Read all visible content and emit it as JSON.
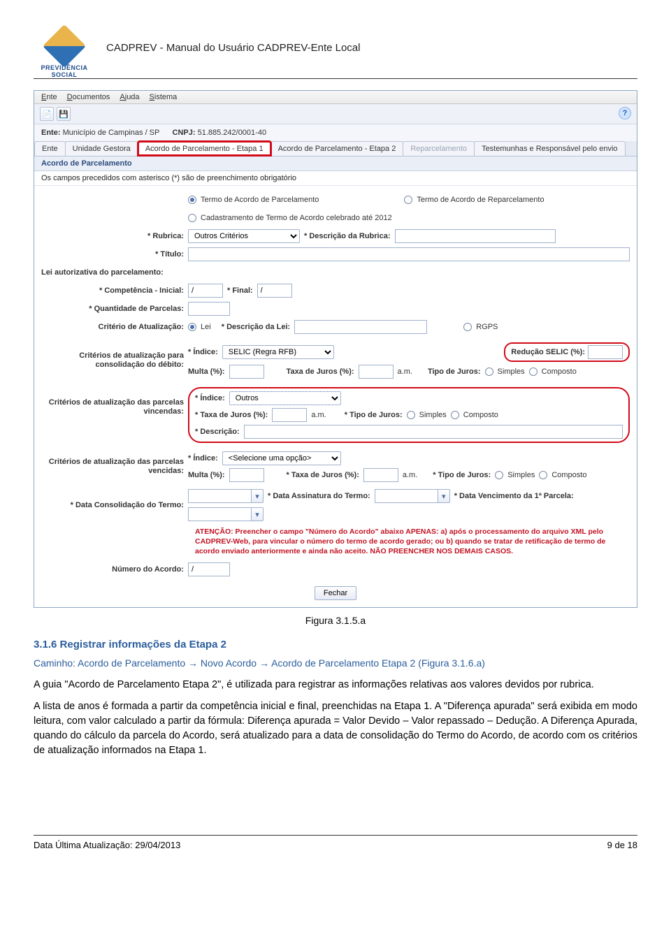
{
  "header": {
    "brand": "PREVIDÊNCIA SOCIAL",
    "title": "CADPREV - Manual do Usuário CADPREV-Ente Local"
  },
  "app": {
    "menu": {
      "ente": "Ente",
      "documentos": "Documentos",
      "ajuda": "Ajuda",
      "sistema": "Sistema"
    },
    "toolIcons": {
      "newDoc": "📄",
      "save": "💾",
      "help": "?"
    },
    "ente": {
      "label": "Ente:",
      "value": "Município de Campinas / SP",
      "cnpj_label": "CNPJ:",
      "cnpj_value": "51.885.242/0001-40"
    },
    "tabs": {
      "t1": "Ente",
      "t2": "Unidade Gestora",
      "t3": "Acordo de Parcelamento - Etapa 1",
      "t4": "Acordo de Parcelamento - Etapa 2",
      "t5": "Reparcelamento",
      "t6": "Testemunhas e Responsável pelo envio"
    },
    "section_title": "Acordo de Parcelamento",
    "hint": "Os campos precedidos com asterisco (*) são de preenchimento obrigatório",
    "radios": {
      "r1": "Termo de Acordo de Parcelamento",
      "r2": "Termo de Acordo de Reparcelamento",
      "r3": "Cadastramento de Termo de Acordo celebrado até 2012"
    },
    "labels": {
      "rubrica": "* Rubrica:",
      "desc_rubrica": "* Descrição da Rubrica:",
      "titulo": "* Título:",
      "lei_aut": "Lei autorizativa do parcelamento:",
      "comp_inicial": "* Competência - Inicial:",
      "final": "* Final:",
      "qtd_parcelas": "* Quantidade de Parcelas:",
      "crit_atual": "Critério de Atualização:",
      "lei_opt": "Lei",
      "desc_lei": "* Descrição da Lei:",
      "rgps": "RGPS",
      "crit_debito": "Critérios de atualização para consolidação do débito:",
      "crit_vincendas": "Critérios de atualização das parcelas vincendas:",
      "crit_vencidas": "Critérios de atualização das parcelas vencidas:",
      "indice": "* Índice:",
      "reducao_selic": "Redução SELIC (%):",
      "multa": "Multa (%):",
      "taxa_juros": "Taxa de Juros (%):",
      "taxa_juros_req": "* Taxa de Juros (%):",
      "am": "a.m.",
      "tipo_juros": "Tipo de Juros:",
      "tipo_juros_req": "* Tipo de Juros:",
      "simples": "Simples",
      "composto": "Composto",
      "descricao": "* Descrição:",
      "data_consol": "* Data Consolidação do Termo:",
      "data_assin": "* Data Assinatura do Termo:",
      "data_venc": "* Data Vencimento da 1ª Parcela:",
      "num_acordo": "Número do Acordo:"
    },
    "selects": {
      "rubrica": "Outros Critérios",
      "indice_debito": "SELIC (Regra RFB)",
      "indice_vincendas": "Outros",
      "indice_vencidas": "<Selecione uma opção>"
    },
    "values": {
      "slash": "/",
      "empty": ""
    },
    "warn": "ATENÇÃO: Preencher o campo \"Número do Acordo\" abaixo APENAS: a) após o processamento do arquivo XML pelo CADPREV-Web, para vincular o número do termo de acordo gerado; ou b) quando se tratar de retificação de termo de acordo enviado anteriormente e ainda não aceito. NÃO PREENCHER NOS DEMAIS CASOS.",
    "close_btn": "Fechar"
  },
  "figure_caption": "Figura 3.1.5.a",
  "section": {
    "heading": "3.1.6  Registrar informações da Etapa 2",
    "path": "Caminho: Acordo de Parcelamento → Novo Acordo → Acordo de Parcelamento Etapa 2 (Figura 3.1.6.a)",
    "p1": "A guia \"Acordo de Parcelamento Etapa 2\", é utilizada para registrar as informações relativas aos valores devidos por rubrica.",
    "p2": "A lista de anos é formada a partir da competência inicial e final, preenchidas na Etapa 1. A \"Diferença apurada\" será exibida em modo leitura, com valor calculado a partir da fórmula: Diferença apurada = Valor Devido – Valor repassado – Dedução. A Diferença Apurada, quando do cálculo da parcela do Acordo, será atualizado para a data de consolidação do Termo do Acordo, de acordo com os critérios de atualização informados na Etapa 1."
  },
  "footer": {
    "left": "Data Última Atualização: 29/04/2013",
    "right": "9 de 18"
  }
}
